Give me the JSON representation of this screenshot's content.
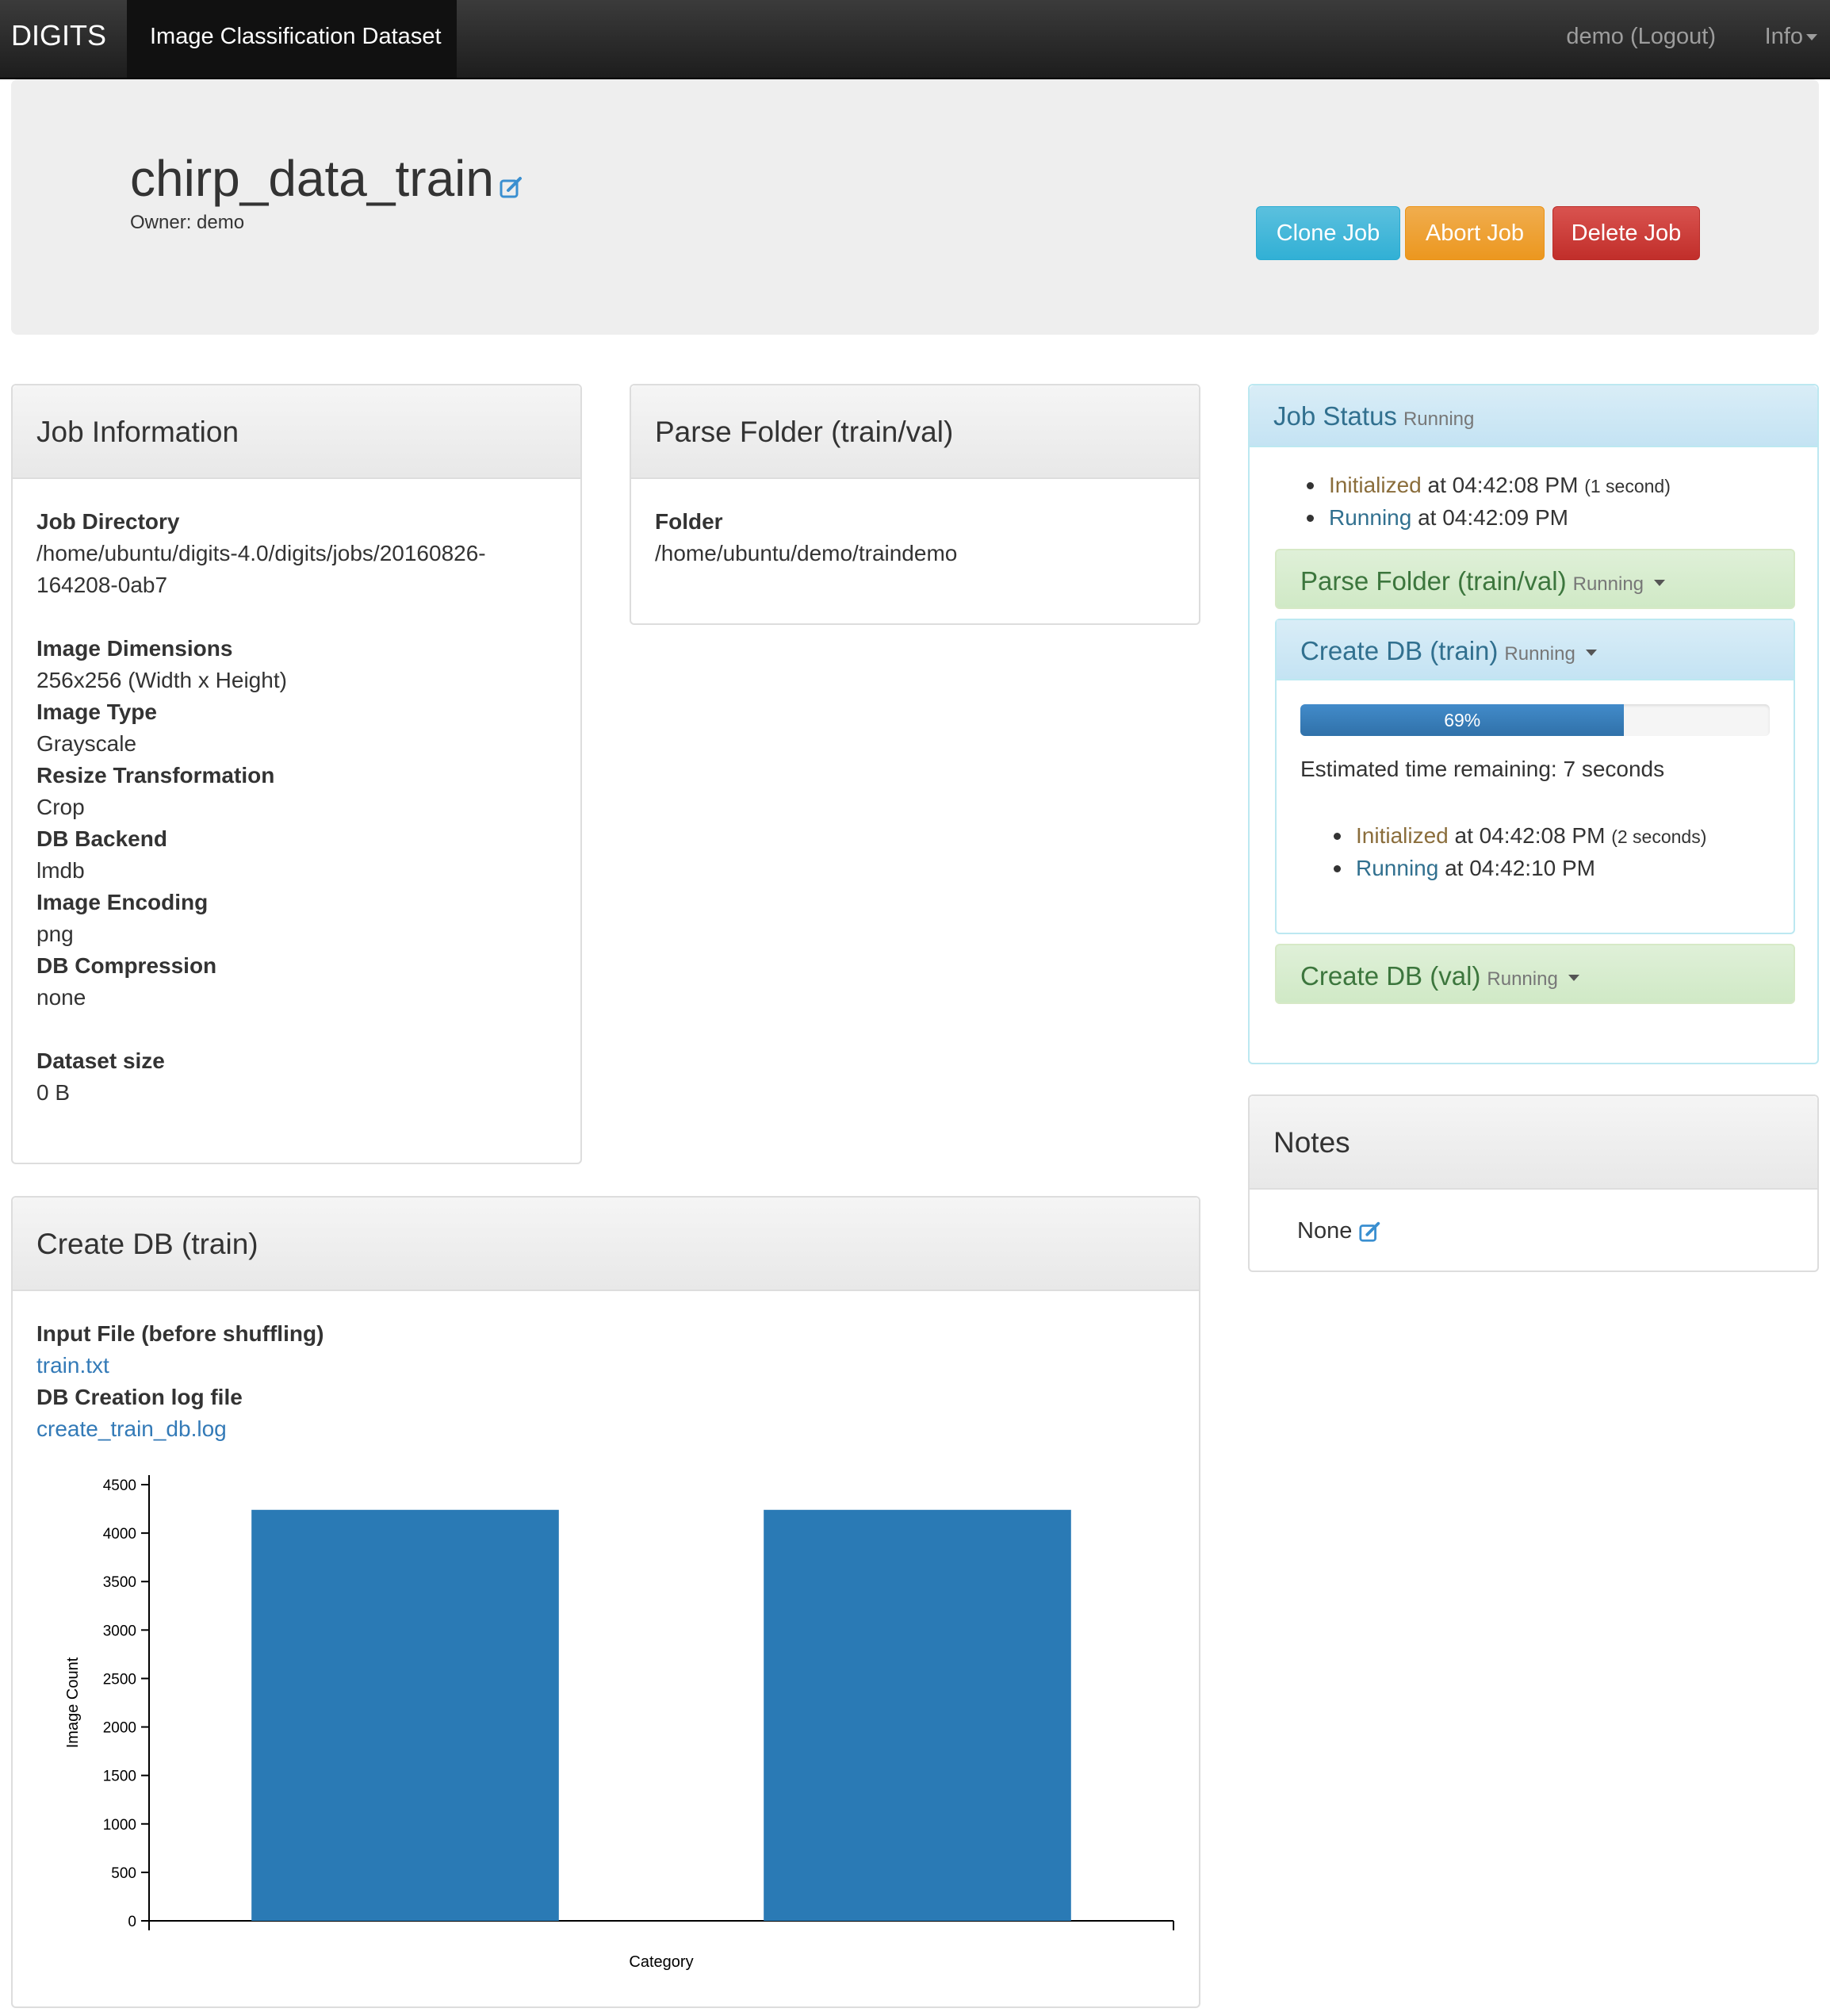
{
  "navbar": {
    "brand": "DIGITS",
    "active_tab": "Image Classification Dataset",
    "user": "demo (Logout)",
    "info": "Info"
  },
  "header": {
    "title": "chirp_data_train",
    "owner": "Owner: demo",
    "buttons": {
      "clone": "Clone Job",
      "abort": "Abort Job",
      "delete": "Delete Job"
    }
  },
  "job_info": {
    "heading": "Job Information",
    "job_directory_label": "Job Directory",
    "job_directory_line1": "/home/ubuntu/digits-4.0/digits/jobs/20160826-",
    "job_directory_line2": "164208-0ab7",
    "image_dimensions_label": "Image Dimensions",
    "image_dimensions": "256x256 (Width x Height)",
    "image_type_label": "Image Type",
    "image_type": "Grayscale",
    "resize_label": "Resize Transformation",
    "resize": "Crop",
    "db_backend_label": "DB Backend",
    "db_backend": "lmdb",
    "image_encoding_label": "Image Encoding",
    "image_encoding": "png",
    "db_compression_label": "DB Compression",
    "db_compression": "none",
    "dataset_size_label": "Dataset size",
    "dataset_size": "0 B"
  },
  "parse_folder": {
    "heading": "Parse Folder (train/val)",
    "folder_label": "Folder",
    "folder": "/home/ubuntu/demo/traindemo"
  },
  "job_status": {
    "heading": "Job Status",
    "state": "Running",
    "events": [
      {
        "name": "Initialized",
        "time": "at 04:42:08 PM",
        "duration": "(1 second)"
      },
      {
        "name": "Running",
        "time": "at 04:42:09 PM"
      }
    ],
    "parse_task": {
      "title": "Parse Folder (train/val)",
      "state": "Running"
    },
    "train_task": {
      "title": "Create DB (train)",
      "state": "Running",
      "progress_label": "69%",
      "progress_value": 0.69,
      "eta": "Estimated time remaining: 7 seconds",
      "events": [
        {
          "name": "Initialized",
          "time": "at 04:42:08 PM",
          "duration": "(2 seconds)"
        },
        {
          "name": "Running",
          "time": "at 04:42:10 PM"
        }
      ]
    },
    "val_task": {
      "title": "Create DB (val)",
      "state": "Running"
    }
  },
  "notes": {
    "heading": "Notes",
    "value": "None"
  },
  "create_db": {
    "heading": "Create DB (train)",
    "input_file_label": "Input File (before shuffling)",
    "input_file": "train.txt",
    "log_label": "DB Creation log file",
    "log_file": "create_train_db.log"
  },
  "chart_data": {
    "type": "bar",
    "categories": [
      "",
      ""
    ],
    "values": [
      4240,
      4240
    ],
    "xlabel": "Category",
    "ylabel": "Image Count",
    "ylim": [
      0,
      4500
    ],
    "yticks": [
      "0",
      "500",
      "1000",
      "1500",
      "2000",
      "2500",
      "3000",
      "3500",
      "4000",
      "4500"
    ],
    "bar_color": "#2a7ab5"
  }
}
